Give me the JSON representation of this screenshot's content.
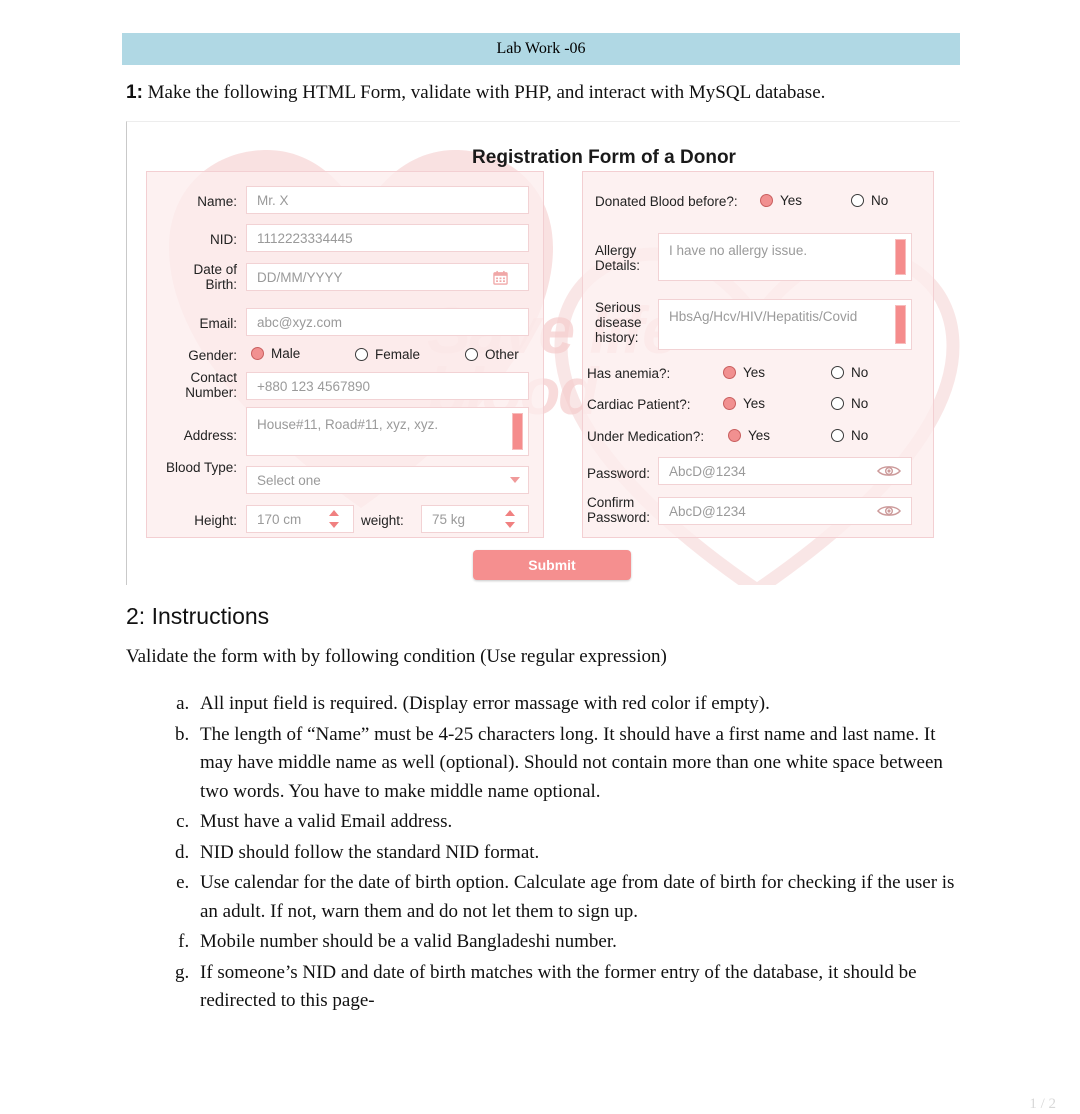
{
  "document": {
    "banner_title": "Lab Work -06",
    "task_number": "1:",
    "task_text": "Make the following HTML Form, validate with PHP, and interact with MySQL database.",
    "page_number": "1 / 2"
  },
  "form": {
    "title": "Registration Form of a Donor",
    "watermark_line1": "Save life",
    "watermark_line2": "blood",
    "left": {
      "name_label": "Name:",
      "name_placeholder": "Mr. X",
      "nid_label": "NID:",
      "nid_placeholder": "1112223334445",
      "dob_label": "Date of Birth:",
      "dob_placeholder": "DD/MM/YYYY",
      "dob_icon": "calendar-icon",
      "email_label": "Email:",
      "email_placeholder": "abc@xyz.com",
      "gender_label": "Gender:",
      "gender_options": [
        {
          "label": "Male",
          "selected": true
        },
        {
          "label": "Female",
          "selected": false
        },
        {
          "label": "Other",
          "selected": false
        }
      ],
      "contact_label": "Contact Number:",
      "contact_placeholder": "+880 123 4567890",
      "address_label": "Address:",
      "address_placeholder": "House#11, Road#11, xyz, xyz.",
      "blood_label": "Blood Type:",
      "blood_placeholder": "Select one",
      "height_label": "Height:",
      "height_placeholder": "170 cm",
      "weight_label": "weight:",
      "weight_placeholder": "75 kg"
    },
    "right": {
      "donated_label": "Donated Blood before?:",
      "donated_options": [
        {
          "label": "Yes",
          "selected": true
        },
        {
          "label": "No",
          "selected": false
        }
      ],
      "allergy_label": "Allergy Details:",
      "allergy_placeholder": "I have no allergy issue.",
      "disease_label": "Serious disease history:",
      "disease_placeholder": "HbsAg/Hcv/HIV/Hepatitis/Covid",
      "anemia_label": "Has anemia?:",
      "anemia_options": [
        {
          "label": "Yes",
          "selected": true
        },
        {
          "label": "No",
          "selected": false
        }
      ],
      "cardiac_label": "Cardiac Patient?:",
      "cardiac_options": [
        {
          "label": "Yes",
          "selected": true
        },
        {
          "label": "No",
          "selected": false
        }
      ],
      "medication_label": "Under Medication?:",
      "medication_options": [
        {
          "label": "Yes",
          "selected": true
        },
        {
          "label": "No",
          "selected": false
        }
      ],
      "password_label": "Password:",
      "password_placeholder": "AbcD@1234",
      "password_icon": "eye-icon",
      "confirm_label": "Confirm Password:",
      "confirm_placeholder": "AbcD@1234",
      "confirm_icon": "eye-icon"
    },
    "submit_label": "Submit"
  },
  "instructions": {
    "heading": "2: Instructions",
    "lead": "Validate the form with by following condition (Use regular expression)",
    "items": [
      "All input field is required. (Display error massage with red color if empty).",
      "The length of “Name” must be 4-25 characters long. It should have a first name and last name. It may have middle name as well (optional). Should not contain more than one white space between two words. You have to make middle name optional.",
      "Must have a valid Email address.",
      "NID should follow the standard NID format.",
      "Use calendar for the date of birth option. Calculate age from date of birth for checking if the user is an adult. If not, warn them and do not let them to sign up.",
      "Mobile number should be a valid Bangladeshi number.",
      "If someone’s NID and date of birth matches with the former entry of the database, it should be redirected to this page-"
    ]
  },
  "colors": {
    "banner": "#b0d8e4",
    "accent_pink": "#f58f8f",
    "panel_pink": "#fdedee",
    "border_pink": "#f2d2d4"
  }
}
